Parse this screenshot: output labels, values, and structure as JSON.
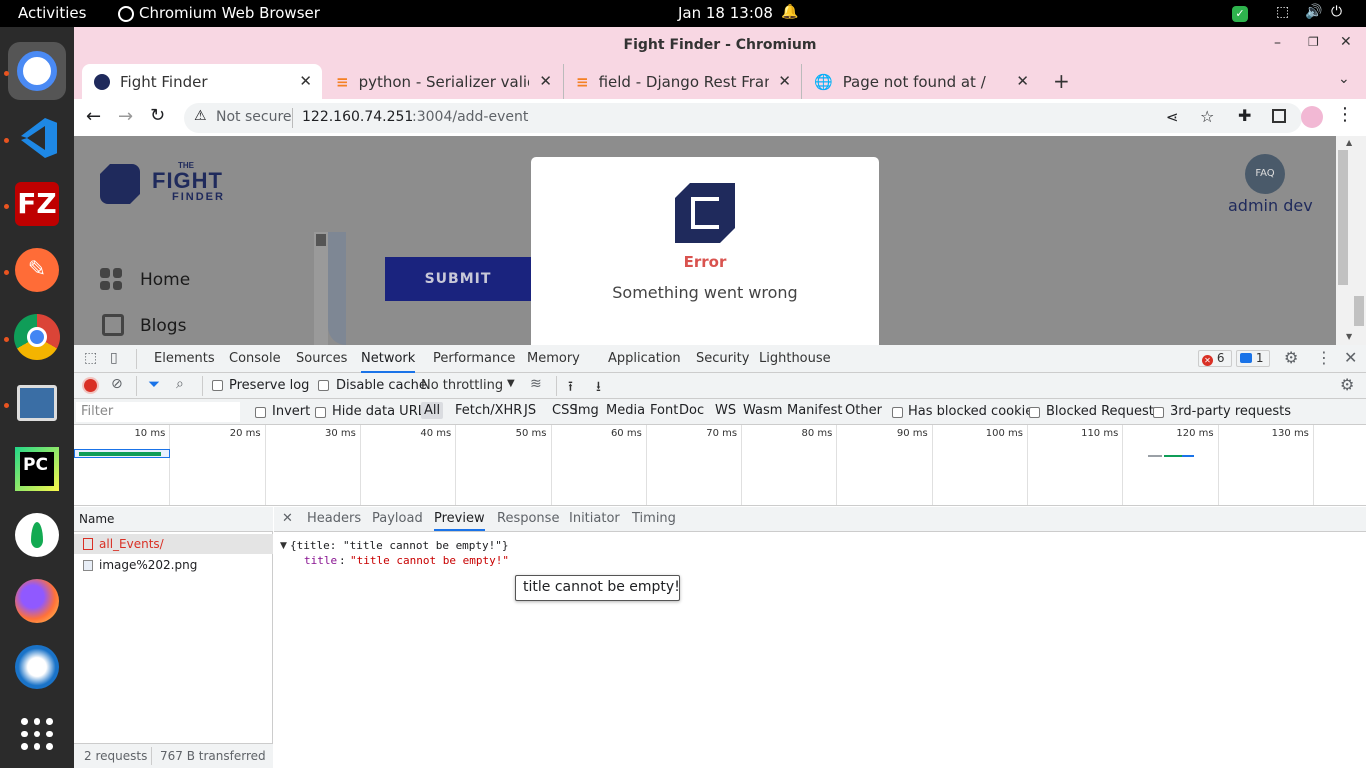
{
  "topbar": {
    "activities": "Activities",
    "app_name": "Chromium Web Browser",
    "clock": "Jan 18  13:08"
  },
  "window": {
    "title": "Fight Finder - Chromium"
  },
  "tabs": [
    {
      "title": "Fight Finder"
    },
    {
      "title": "python - Serializer validati"
    },
    {
      "title": "field - Django Rest Framew"
    },
    {
      "title": "Page not found at /"
    }
  ],
  "omnibox": {
    "security": "Not secure",
    "host": "122.160.74.251",
    "path": ":3004/add-event"
  },
  "site": {
    "logo_line1": "THE",
    "logo_line2": "FIGHT",
    "logo_line3": "FINDER",
    "username": "admin dev",
    "nav": [
      {
        "label": "Home"
      },
      {
        "label": "Blogs"
      }
    ],
    "submit_label": "SUBMIT",
    "modal": {
      "heading": "Error",
      "message": "Something went wrong"
    }
  },
  "devtools": {
    "tabs": [
      "Elements",
      "Console",
      "Sources",
      "Network",
      "Performance",
      "Memory",
      "Application",
      "Security",
      "Lighthouse"
    ],
    "active_tab": "Network",
    "error_count": "6",
    "message_count": "1",
    "toolbar": {
      "preserve_log": "Preserve log",
      "disable_cache": "Disable cache",
      "throttling": "No throttling"
    },
    "filter": {
      "placeholder": "Filter",
      "invert": "Invert",
      "hide_data_urls": "Hide data URLs",
      "types": [
        "All",
        "Fetch/XHR",
        "JS",
        "CSS",
        "Img",
        "Media",
        "Font",
        "Doc",
        "WS",
        "Wasm",
        "Manifest",
        "Other"
      ],
      "has_blocked_cookies": "Has blocked cookies",
      "blocked_requests": "Blocked Requests",
      "third_party": "3rd-party requests"
    },
    "timeline_ticks": [
      "10 ms",
      "20 ms",
      "30 ms",
      "40 ms",
      "50 ms",
      "60 ms",
      "70 ms",
      "80 ms",
      "90 ms",
      "100 ms",
      "110 ms",
      "120 ms",
      "130 ms"
    ],
    "requests_header": "Name",
    "requests": [
      {
        "name": "all_Events/",
        "error": true
      },
      {
        "name": "image%202.png",
        "error": false
      }
    ],
    "status": {
      "requests": "2 requests",
      "transferred": "767 B transferred"
    },
    "detail_tabs": [
      "Headers",
      "Payload",
      "Preview",
      "Response",
      "Initiator",
      "Timing"
    ],
    "active_detail_tab": "Preview",
    "preview": {
      "summary": "{title: \"title cannot be empty!\"}",
      "key": "title",
      "value": "\"title cannot be empty!\""
    },
    "tooltip": "title cannot be empty!"
  },
  "colors": {
    "accent_blue": "#1a73e8",
    "error_red": "#d93025",
    "brand_navy": "#1f2a5c",
    "submit_blue": "#1a237e",
    "tab_strip": "#f8d7e3"
  }
}
